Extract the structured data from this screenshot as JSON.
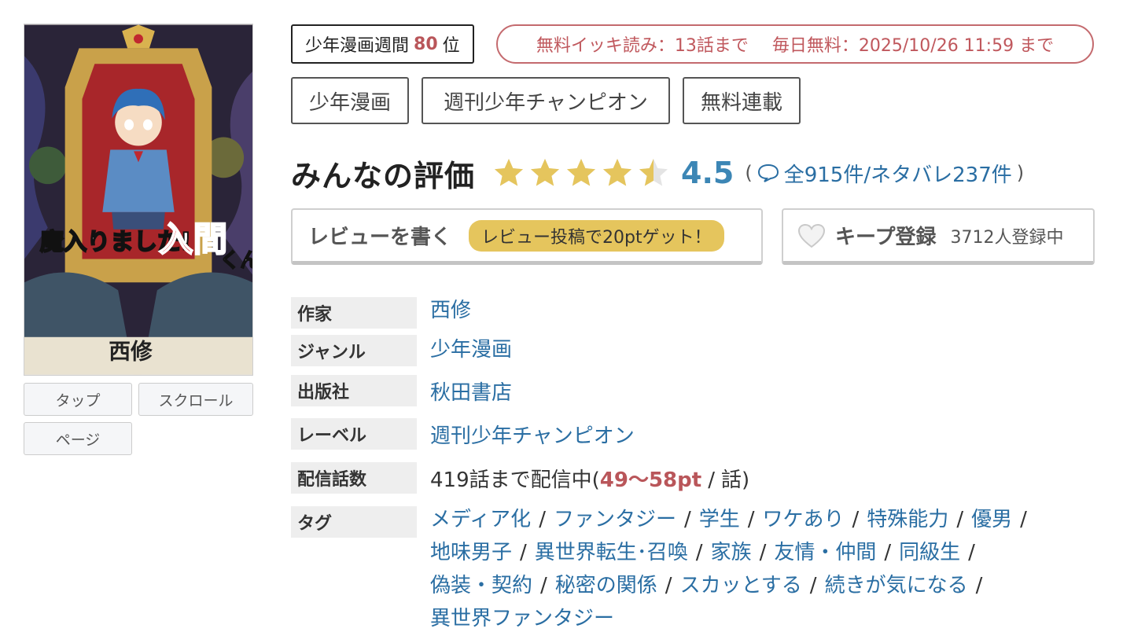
{
  "cover": {
    "title_left": "魔入りました!",
    "title_big": "入間",
    "title_small": "くん",
    "author_mark": "西修"
  },
  "viewer_buttons": {
    "tap": "タップ",
    "scroll": "スクロール",
    "page": "ページ"
  },
  "ranking": {
    "prefix": "少年漫画週間",
    "rank": "80",
    "suffix": "位"
  },
  "free_info": {
    "ikki": "無料イッキ読み：13話まで",
    "daily": "毎日無料：2025/10/26 11:59 まで"
  },
  "categories": [
    "少年漫画",
    "週刊少年チャンピオン",
    "無料連載"
  ],
  "rating": {
    "title": "みんなの評価",
    "score": "4.5",
    "stars_value": 4.5,
    "stars_max": 5,
    "open_paren": "(",
    "reviews": "全915件/ネタバレ237件",
    "close_paren": ")"
  },
  "actions": {
    "review_label": "レビューを書く",
    "review_bonus": "レビュー投稿で20ptゲット！",
    "keep_label": "キープ登録",
    "keep_count": "3712人登録中"
  },
  "info": {
    "author_label": "作家",
    "author": "西修",
    "genre_label": "ジャンル",
    "genre": "少年漫画",
    "publisher_label": "出版社",
    "publisher": "秋田書店",
    "label_label": "レーベル",
    "label": "週刊少年チャンピオン",
    "episodes_label": "配信話数",
    "episodes_prefix": "419話まで配信中(",
    "episodes_price": "49〜58pt",
    "episodes_sep": "/",
    "episodes_suffix": "話)",
    "tags_label": "タグ"
  },
  "tags": [
    "メディア化",
    "ファンタジー",
    "学生",
    "ワケあり",
    "特殊能力",
    "優男",
    "地味男子",
    "異世界転生･召喚",
    "家族",
    "友情・仲間",
    "同級生",
    "偽装・契約",
    "秘密の関係",
    "スカッとする",
    "続きが気になる",
    "異世界ファンタジー"
  ],
  "colors": {
    "accent_red": "#b9565a",
    "link_blue": "#2a6ea3",
    "star_gold": "#e5c55d",
    "bonus_yellow": "#e5c55d"
  }
}
